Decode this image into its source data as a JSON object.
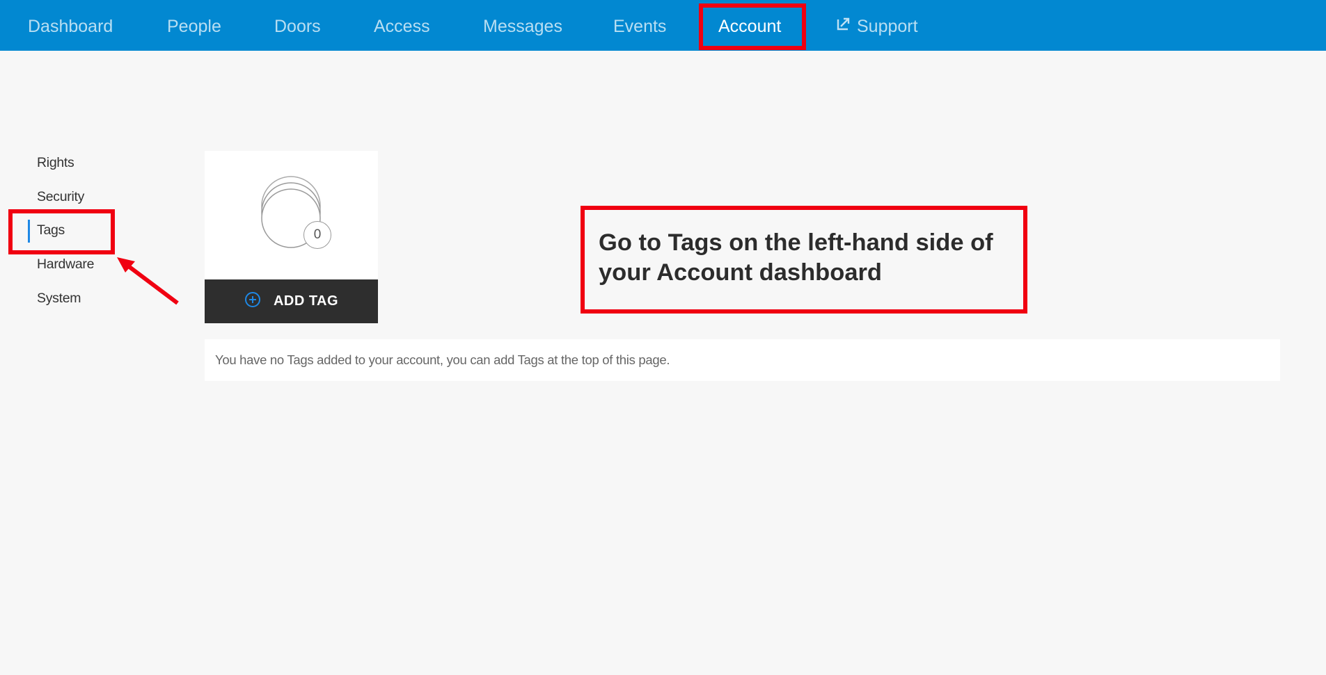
{
  "nav": {
    "items": [
      {
        "label": "Dashboard"
      },
      {
        "label": "People"
      },
      {
        "label": "Doors"
      },
      {
        "label": "Access"
      },
      {
        "label": "Messages"
      },
      {
        "label": "Events"
      },
      {
        "label": "Account"
      },
      {
        "label": "Support",
        "icon": "external-link-icon"
      }
    ],
    "active": "Account"
  },
  "sidebar": {
    "items": [
      {
        "label": "Rights"
      },
      {
        "label": "Security"
      },
      {
        "label": "Tags"
      },
      {
        "label": "Hardware"
      },
      {
        "label": "System"
      }
    ],
    "active": "Tags"
  },
  "tag_card": {
    "count": "0",
    "add_label": "ADD TAG",
    "icon": "plus-circle-icon"
  },
  "empty_message": "You have no Tags added to your account, you can add Tags at the top of this page.",
  "annotation": {
    "text": "Go to Tags on the left-hand side of your Account dashboard"
  },
  "colors": {
    "nav_bg": "#0288d1",
    "highlight": "#f00011",
    "button_bg": "#2e2e2e",
    "page_bg": "#f7f7f7",
    "accent": "#1e88e5"
  }
}
